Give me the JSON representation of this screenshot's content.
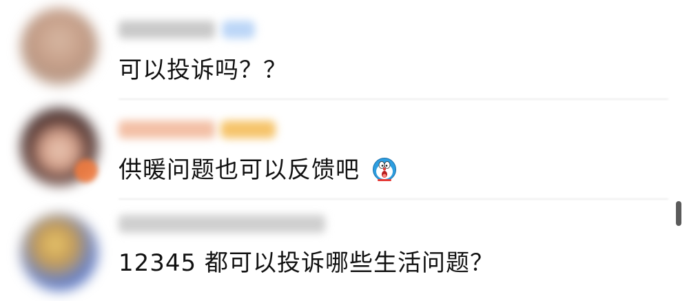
{
  "comments": [
    {
      "text": "可以投诉吗？？"
    },
    {
      "text": "供暖问题也可以反馈吧",
      "emoji": "doraemon-icon"
    },
    {
      "text": "12345 都可以投诉哪些生活问题？"
    }
  ],
  "colors": {
    "text": "#111111",
    "divider": "#ededed",
    "scrollbar": "#5b5b5b",
    "badge": "#f07b3f",
    "tag_blue": "#bcd6f7",
    "tag_gold": "#f6c46b"
  }
}
